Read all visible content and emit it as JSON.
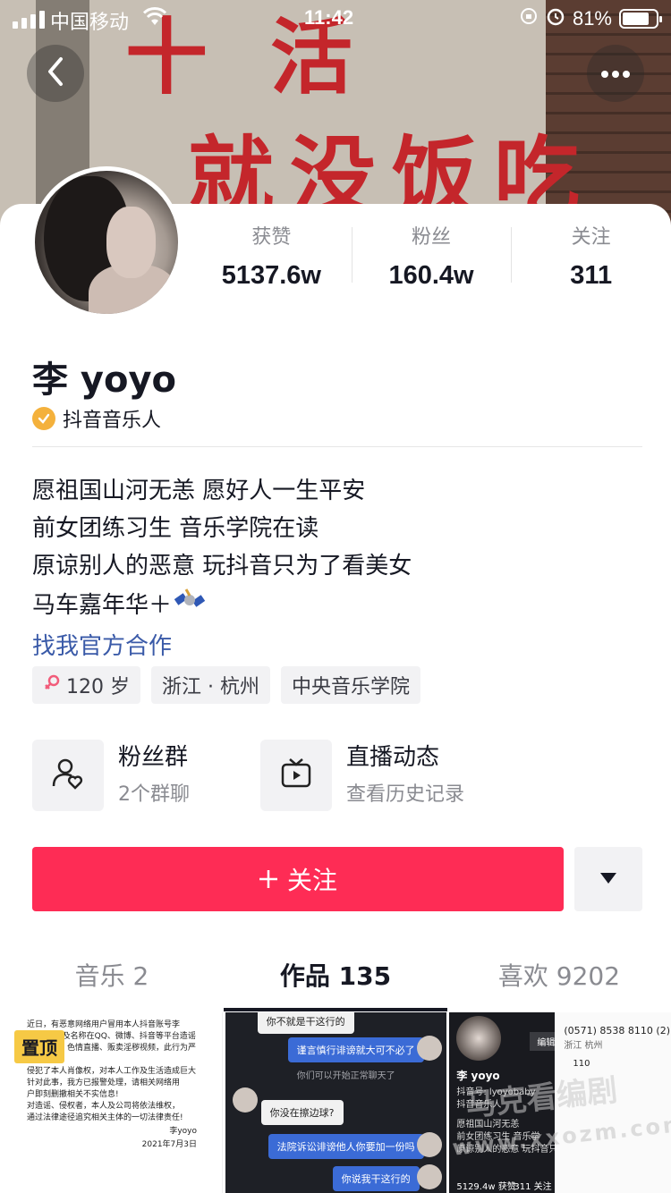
{
  "status_bar": {
    "carrier": "中国移动",
    "time": "11:42",
    "battery": "81%",
    "battery_level": 0.81
  },
  "cover": {
    "sign_text_top": "十活",
    "sign_text": "就没饭吃"
  },
  "stats": [
    {
      "label": "获赞",
      "value": "5137.6w"
    },
    {
      "label": "粉丝",
      "value": "160.4w"
    },
    {
      "label": "关注",
      "value": "311"
    }
  ],
  "profile": {
    "name": "李 yoyo",
    "verification": "抖音音乐人",
    "bio": [
      "愿祖国山河无恙 愿好人一生平安",
      "前女团练习生 音乐学院在读",
      "原谅别人的恶意 玩抖音只为了看美女",
      "马车嘉年华＋"
    ],
    "cooperate_link": "找我官方合作",
    "tags": [
      "120 岁",
      "浙江 · 杭州",
      "中央音乐学院"
    ]
  },
  "features": {
    "fans_group": {
      "title": "粉丝群",
      "subtitle": "2个群聊"
    },
    "live": {
      "title": "直播动态",
      "subtitle": "查看历史记录"
    }
  },
  "actions": {
    "follow": "关注"
  },
  "tabs": [
    {
      "label": "音乐 2"
    },
    {
      "label": "作品 135"
    },
    {
      "label": "喜欢 9202"
    }
  ],
  "grid": {
    "pinned": "置顶",
    "notice_lines": [
      "近日，有恶意网络用户冒用本人抖音账号李",
      "yoyo头像及名称在QQ、微博、抖音等平台造谣",
      "发布低俗、色情直播、贩卖淫秽视频，此行为严重",
      "侵犯了本人肖像权，对本人工作及生活造成巨大",
      "针对此事，我方已报警处理，请相关网络用",
      "户即刻删撤相关不实信息!",
      "对造谣、侵权者，本人及公司将依法维权，",
      "通过法律途径追究相关主体的一切法律责任!"
    ],
    "notice_sign": "李yoyo",
    "notice_date": "2021年7月3日",
    "chat": {
      "top": "你不就是干这行的",
      "b1": "谨言慎行诽谤就大可不必了",
      "hint": "你们可以开始正常聊天了",
      "b2": "你没在擦边球?",
      "b3": "法院诉讼诽谤他人你要加一份吗",
      "b4": "你说我干这行的"
    },
    "mini_profile": {
      "name": "李 yoyo",
      "id": "抖音号: lyoyobaby",
      "verify": "抖音音乐人",
      "bio1": "愿祖国山河无恙",
      "bio2": "前女团练习生 音乐学",
      "bio3": "原谅别人的恶意 玩抖音只为了",
      "likes": "5129.4w 获赞",
      "following": "311 关注",
      "edit": "编辑",
      "phone": "(0571) 8538 8110 (2)",
      "loc": "浙江 杭州",
      "num": "110"
    }
  },
  "watermark": {
    "line1": "马克看编剧",
    "line2": "www.xxozm.com"
  },
  "colors": {
    "accent": "#fe2c55",
    "link": "#3a5aa8",
    "verify": "#f4b13c"
  }
}
